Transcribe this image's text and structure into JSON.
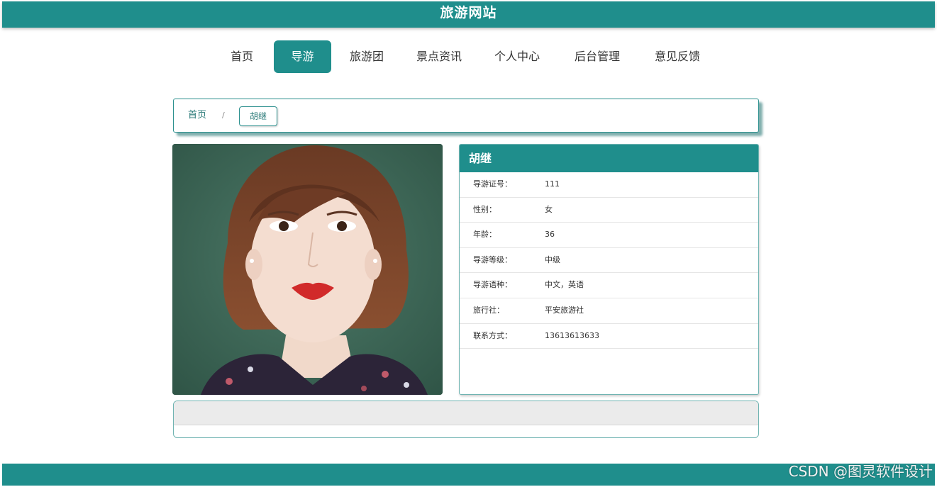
{
  "header": {
    "site_title": "旅游网站"
  },
  "nav": {
    "items": [
      {
        "label": "首页",
        "active": false
      },
      {
        "label": "导游",
        "active": true
      },
      {
        "label": "旅游团",
        "active": false
      },
      {
        "label": "景点资讯",
        "active": false
      },
      {
        "label": "个人中心",
        "active": false
      },
      {
        "label": "后台管理",
        "active": false
      },
      {
        "label": "意见反馈",
        "active": false
      }
    ]
  },
  "breadcrumb": {
    "home": "首页",
    "separator": "/",
    "current": "胡继"
  },
  "guide": {
    "name": "胡继",
    "fields": [
      {
        "label": "导游证号：",
        "value": "111"
      },
      {
        "label": "性别：",
        "value": "女"
      },
      {
        "label": "年龄：",
        "value": "36"
      },
      {
        "label": "导游等级：",
        "value": "中级"
      },
      {
        "label": "导游语种：",
        "value": "中文，英语"
      },
      {
        "label": "旅行社：",
        "value": "平安旅游社"
      },
      {
        "label": "联系方式：",
        "value": "13613613633"
      }
    ]
  },
  "watermark": "CSDN @图灵软件设计",
  "colors": {
    "accent": "#1f8e8c",
    "border": "#6fb3b1"
  }
}
